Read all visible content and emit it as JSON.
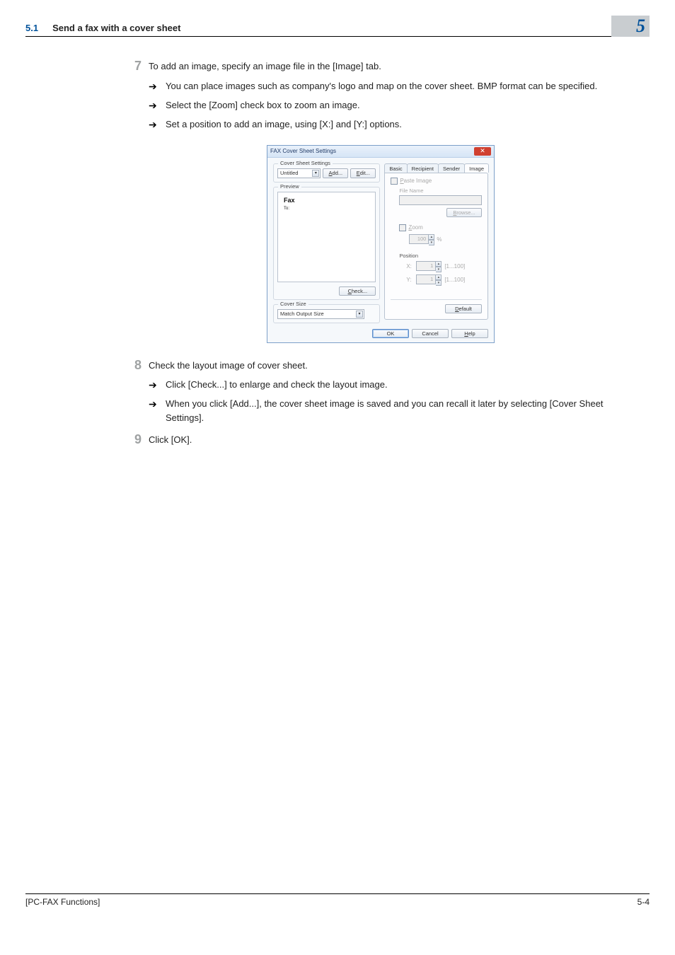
{
  "header": {
    "num": "5.1",
    "title": "Send a fax with a cover sheet",
    "chapter": "5"
  },
  "steps": {
    "s7": {
      "num": "7",
      "text": "To add an image, specify an image file in the [Image] tab.",
      "sub": [
        "You can place images such as company's logo and map on the cover sheet. BMP format can be specified.",
        "Select the [Zoom] check box to zoom an image.",
        "Set a position to add an image, using [X:] and [Y:] options."
      ]
    },
    "s8": {
      "num": "8",
      "text": "Check the layout image of cover sheet.",
      "sub": [
        "Click [Check...] to enlarge and check the layout image.",
        "When you click [Add...], the cover sheet image is saved and you can recall it later by selecting [Cover Sheet Settings]."
      ]
    },
    "s9": {
      "num": "9",
      "text": "Click [OK]."
    }
  },
  "dialog": {
    "title": "FAX Cover Sheet Settings",
    "cover_sheet_group": "Cover Sheet Settings",
    "cover_select": "Untitled",
    "add_btn": "Add...",
    "edit_btn": "Edit...",
    "preview_group": "Preview",
    "preview_title": "Fax",
    "preview_line": "To:",
    "check_btn": "Check...",
    "cover_size_group": "Cover Size",
    "cover_size_select": "Match Output Size",
    "tabs": {
      "basic": "Basic",
      "recipient": "Recipient",
      "sender": "Sender",
      "image": "Image"
    },
    "image_panel": {
      "paste": "Paste Image",
      "file_name": "File Name",
      "browse": "Browse...",
      "zoom": "Zoom",
      "zoom_val": "100",
      "zoom_pct": "%",
      "position": "Position",
      "x_label": "X:",
      "x_val": "1",
      "x_range": "[1...100]",
      "y_label": "Y:",
      "y_val": "1",
      "y_range": "[1...100]"
    },
    "default_btn": "Default",
    "ok": "OK",
    "cancel": "Cancel",
    "help": "Help"
  },
  "footer": {
    "left": "[PC-FAX Functions]",
    "right": "5-4"
  }
}
